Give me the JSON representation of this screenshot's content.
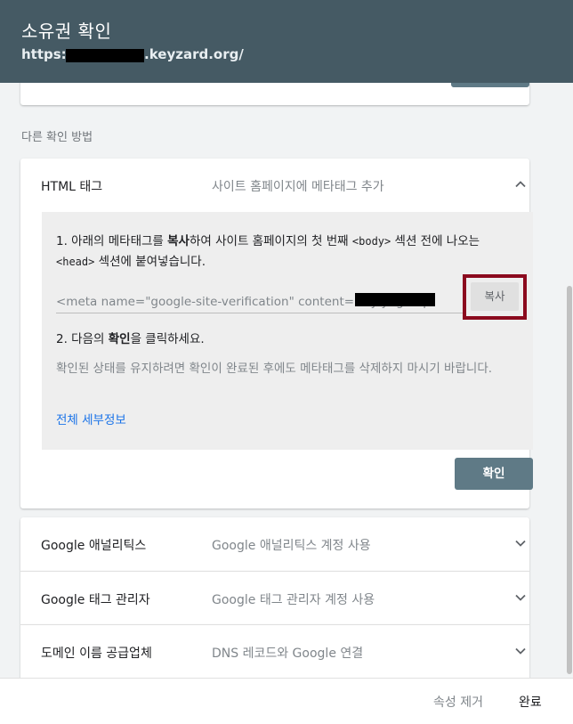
{
  "header": {
    "title": "소유권 확인",
    "url_prefix": "https://",
    "url_suffix": ".keyzard.org/"
  },
  "section_label": "다른 확인 방법",
  "methods": [
    {
      "name": "HTML 태그",
      "desc": "사이트 홈페이지에 메타태그 추가",
      "expanded": true,
      "step1_a": "1. 아래의 메타태그를 ",
      "step1_bold": "복사",
      "step1_b": "하여 사이트 홈페이지의 첫 번째 ",
      "step1_code1": "<body>",
      "step1_c": " 섹션 전에 나오는 ",
      "step1_code2": "<head>",
      "step1_d": " 섹션에 붙여넣습니다.",
      "meta_value": "<meta name=\"google-site-verification\" content=\"lbyIy8g          7lq4",
      "copy_label": "복사",
      "step2_a": "2. 다음의 ",
      "step2_bold": "확인",
      "step2_b": "을 클릭하세요.",
      "note": "확인된 상태를 유지하려면 확인이 완료된 후에도 메타태그를 삭제하지 마시기 바랍니다.",
      "details_link": "전체 세부정보",
      "confirm_label": "확인"
    },
    {
      "name": "Google 애널리틱스",
      "desc": "Google 애널리틱스 계정 사용"
    },
    {
      "name": "Google 태그 관리자",
      "desc": "Google 태그 관리자 계정 사용"
    },
    {
      "name": "도메인 이름 공급업체",
      "desc": "DNS 레코드와 Google 연결"
    }
  ],
  "footer": {
    "remove_label": "속성 제거",
    "done_label": "완료"
  },
  "colors": {
    "header_bg": "#455a64",
    "primary_button": "#5f7a86",
    "link": "#1a73e8",
    "highlight_border": "#8b0a1e"
  },
  "icons": {
    "chevron_up": "chevron-up-icon",
    "chevron_down": "chevron-down-icon"
  }
}
